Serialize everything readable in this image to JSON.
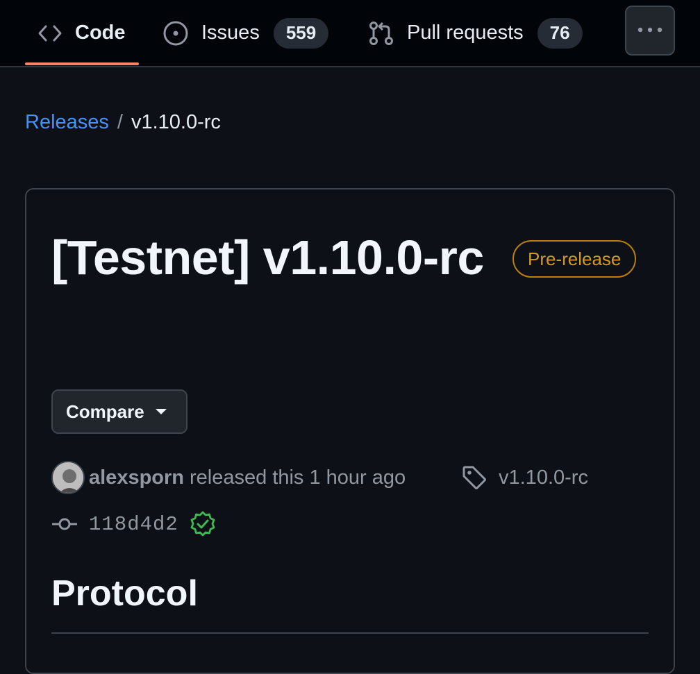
{
  "nav": {
    "tabs": [
      {
        "label": "Code",
        "icon": "code-icon",
        "selected": true
      },
      {
        "label": "Issues",
        "icon": "issue-opened-icon",
        "count": "559"
      },
      {
        "label": "Pull requests",
        "icon": "git-pull-request-icon",
        "count": "76"
      }
    ],
    "more_icon": "kebab-horizontal-icon",
    "accent_color": "#f78166"
  },
  "breadcrumb": {
    "parent": "Releases",
    "separator": "/",
    "current": "v1.10.0-rc"
  },
  "release": {
    "title": "[Testnet] v1.10.0-rc",
    "badge": "Pre-release",
    "badge_color": "#d29922",
    "compare_label": "Compare",
    "author": "alexsporn",
    "released_text": "released this 1 hour ago",
    "tag": "v1.10.0-rc",
    "commit": "118d4d2",
    "verified_color": "#3fb950",
    "section_heading": "Protocol"
  }
}
